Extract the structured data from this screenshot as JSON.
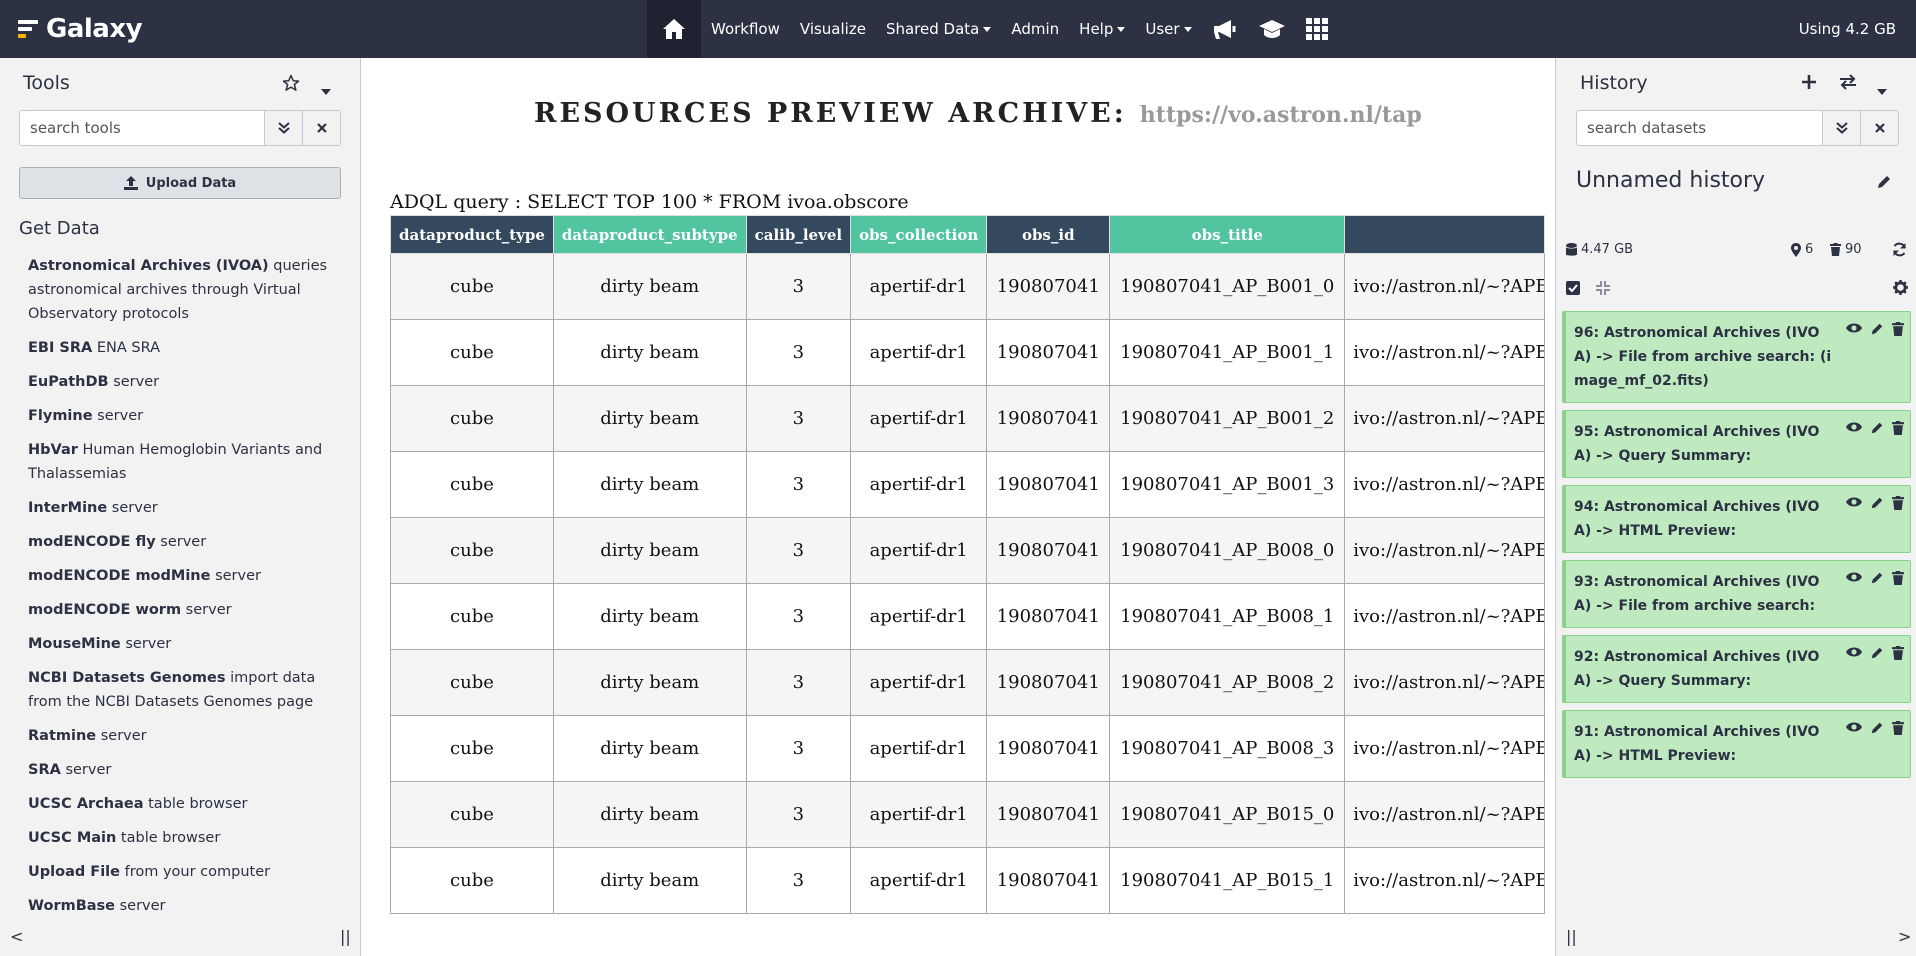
{
  "masthead": {
    "brand": "Galaxy",
    "nav": {
      "workflow": "Workflow",
      "visualize": "Visualize",
      "shared_data": "Shared Data",
      "admin": "Admin",
      "help": "Help",
      "user": "User"
    },
    "quota": "Using 4.2 GB",
    "colors": {
      "background": "#2c3143",
      "active": "#1f2230"
    }
  },
  "tool_panel": {
    "title": "Tools",
    "search_placeholder": "search tools",
    "upload_label": "Upload Data",
    "section_title": "Get Data",
    "tools": [
      {
        "name": "Astronomical Archives (IVOA)",
        "desc": " queries astronomical archives through Virtual Observatory protocols"
      },
      {
        "name": "EBI SRA",
        "desc": " ENA SRA"
      },
      {
        "name": "EuPathDB",
        "desc": " server"
      },
      {
        "name": "Flymine",
        "desc": " server"
      },
      {
        "name": "HbVar",
        "desc": " Human Hemoglobin Variants and Thalassemias"
      },
      {
        "name": "InterMine",
        "desc": " server"
      },
      {
        "name": "modENCODE fly",
        "desc": " server"
      },
      {
        "name": "modENCODE modMine",
        "desc": " server"
      },
      {
        "name": "modENCODE worm",
        "desc": " server"
      },
      {
        "name": "MouseMine",
        "desc": " server"
      },
      {
        "name": "NCBI Datasets Genomes",
        "desc": " import data from the NCBI Datasets Genomes page"
      },
      {
        "name": "Ratmine",
        "desc": " server"
      },
      {
        "name": "SRA",
        "desc": " server"
      },
      {
        "name": "UCSC Archaea",
        "desc": " table browser"
      },
      {
        "name": "UCSC Main",
        "desc": " table browser"
      },
      {
        "name": "Upload File",
        "desc": " from your computer"
      },
      {
        "name": "WormBase",
        "desc": " server"
      }
    ],
    "collapse_glyph": "<",
    "resize_glyph": "||"
  },
  "center": {
    "title": "RESOURCES PREVIEW ARCHIVE:",
    "archive_url": "https://vo.astron.nl/tap",
    "query": "ADQL query : SELECT TOP 100 * FROM ivoa.obscore",
    "columns": [
      "dataproduct_type",
      "dataproduct_subtype",
      "calib_level",
      "obs_collection",
      "obs_id",
      "obs_title",
      ""
    ],
    "column_colors": {
      "dark": "#34495e",
      "green": "#52c4a0"
    },
    "rows": [
      [
        "cube",
        "dirty beam",
        "3",
        "apertif-dr1",
        "190807041",
        "190807041_AP_B001_0",
        "ivo://astron.nl/~?APE"
      ],
      [
        "cube",
        "dirty beam",
        "3",
        "apertif-dr1",
        "190807041",
        "190807041_AP_B001_1",
        "ivo://astron.nl/~?APE"
      ],
      [
        "cube",
        "dirty beam",
        "3",
        "apertif-dr1",
        "190807041",
        "190807041_AP_B001_2",
        "ivo://astron.nl/~?APE"
      ],
      [
        "cube",
        "dirty beam",
        "3",
        "apertif-dr1",
        "190807041",
        "190807041_AP_B001_3",
        "ivo://astron.nl/~?APE"
      ],
      [
        "cube",
        "dirty beam",
        "3",
        "apertif-dr1",
        "190807041",
        "190807041_AP_B008_0",
        "ivo://astron.nl/~?APE"
      ],
      [
        "cube",
        "dirty beam",
        "3",
        "apertif-dr1",
        "190807041",
        "190807041_AP_B008_1",
        "ivo://astron.nl/~?APE"
      ],
      [
        "cube",
        "dirty beam",
        "3",
        "apertif-dr1",
        "190807041",
        "190807041_AP_B008_2",
        "ivo://astron.nl/~?APE"
      ],
      [
        "cube",
        "dirty beam",
        "3",
        "apertif-dr1",
        "190807041",
        "190807041_AP_B008_3",
        "ivo://astron.nl/~?APE"
      ],
      [
        "cube",
        "dirty beam",
        "3",
        "apertif-dr1",
        "190807041",
        "190807041_AP_B015_0",
        "ivo://astron.nl/~?APE"
      ],
      [
        "cube",
        "dirty beam",
        "3",
        "apertif-dr1",
        "190807041",
        "190807041_AP_B015_1",
        "ivo://astron.nl/~?APE"
      ]
    ]
  },
  "history_panel": {
    "title": "History",
    "search_placeholder": "search datasets",
    "name": "Unnamed history",
    "size": "4.47 GB",
    "shown_count": "6",
    "deleted_count": "90",
    "datasets": [
      {
        "label": "96: Astronomical Archives (IVOA) -> File from archive search: (image_mf_02.fits)"
      },
      {
        "label": "95: Astronomical Archives (IVOA) -> Query Summary:"
      },
      {
        "label": "94: Astronomical Archives (IVOA) -> HTML Preview:"
      },
      {
        "label": "93: Astronomical Archives (IVOA) -> File from archive search:"
      },
      {
        "label": "92: Astronomical Archives (IVOA) -> Query Summary:"
      },
      {
        "label": "91: Astronomical Archives (IVOA) -> HTML Preview:"
      }
    ],
    "dataset_color": "#bfeabf",
    "resize_glyph": "||",
    "collapse_glyph": ">"
  }
}
